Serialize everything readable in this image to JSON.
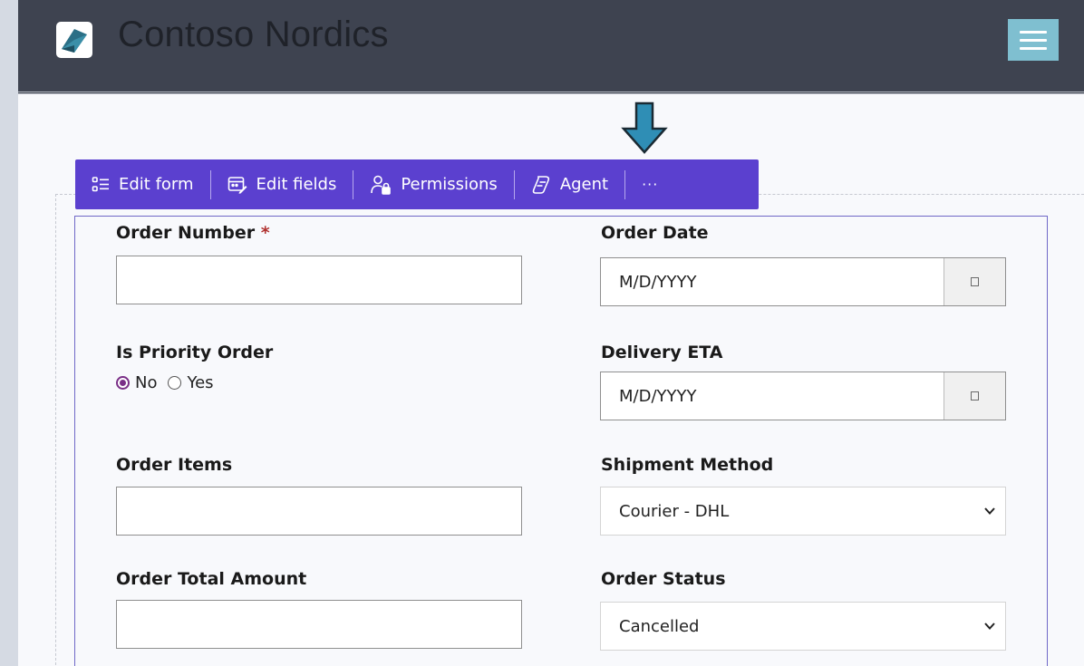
{
  "app": {
    "brand": "Contoso Nordics",
    "logo_icon": "contoso-logo-icon",
    "menu_icon": "hamburger-menu-icon"
  },
  "toolbar": {
    "edit_form": "Edit form",
    "edit_fields": "Edit fields",
    "permissions": "Permissions",
    "agent": "Agent",
    "more": "···"
  },
  "form": {
    "order_number": {
      "label": "Order Number",
      "required_mark": "*",
      "value": ""
    },
    "order_date": {
      "label": "Order Date",
      "value": "M/D/YYYY"
    },
    "is_priority": {
      "label": "Is Priority Order",
      "options": [
        "No",
        "Yes"
      ],
      "selected": "No"
    },
    "delivery_eta": {
      "label": "Delivery ETA",
      "value": "M/D/YYYY"
    },
    "order_items": {
      "label": "Order Items",
      "value": ""
    },
    "shipment_method": {
      "label": "Shipment Method",
      "value": "Courier - DHL"
    },
    "order_total": {
      "label": "Order Total Amount",
      "value": ""
    },
    "order_status": {
      "label": "Order Status",
      "value": "Cancelled"
    }
  },
  "colors": {
    "header_bg": "#3e4350",
    "toolbar_bg": "#5b40cf",
    "menu_button": "#7fbfd0",
    "arrow": "#2f8eb5",
    "radio_accent": "#7a2f87",
    "required": "#b0312f"
  }
}
